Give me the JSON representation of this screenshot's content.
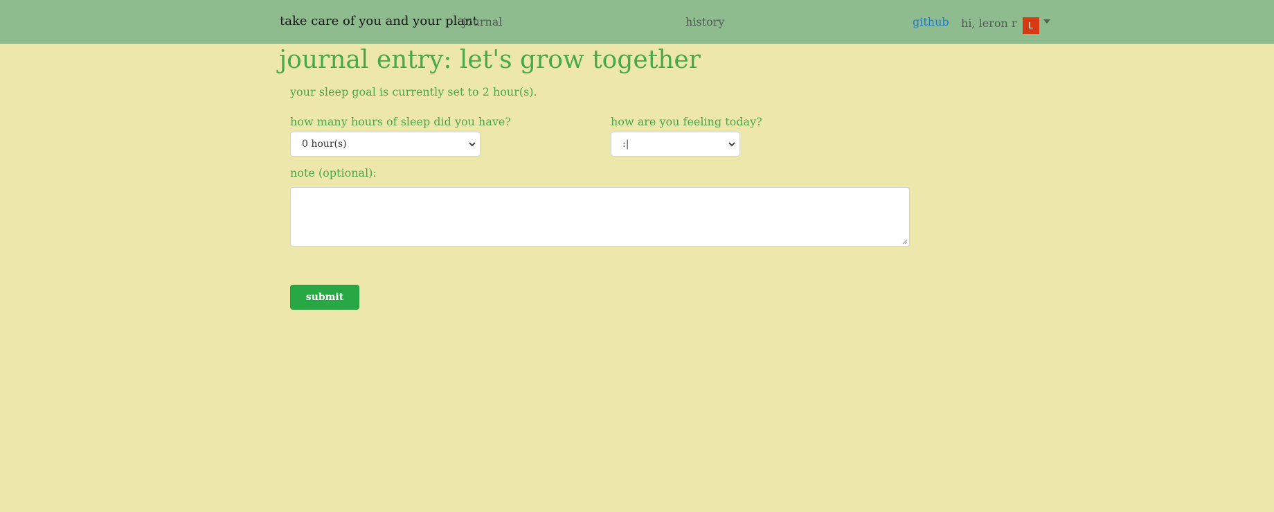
{
  "navbar": {
    "brand": "take care of you and your plant",
    "links": [
      {
        "label": "journal"
      },
      {
        "label": "history"
      }
    ],
    "github_label": "github",
    "user_greeting": "hi, leron r",
    "avatar_initial": "L",
    "avatar_color": "#d53a12",
    "background_color": "#8fbc8f"
  },
  "main": {
    "title": "journal entry: let's grow together",
    "goal_text": "your sleep goal is currently set to 2 hour(s).",
    "sleep_field": {
      "label": "how many hours of sleep did you have?",
      "selected": "0 hour(s)"
    },
    "feeling_field": {
      "label": "how are you feeling today?",
      "selected": ":|"
    },
    "note_field": {
      "label": "note (optional):",
      "value": ""
    },
    "submit_label": "submit",
    "accent_color": "#48a948",
    "button_color": "#28a745",
    "page_background": "#ede7ab"
  },
  "icons": {
    "user_menu_caret": "caret-down-icon",
    "select_chevron": "chevron-down-icon",
    "textarea_resize": "resize-grip-icon"
  }
}
